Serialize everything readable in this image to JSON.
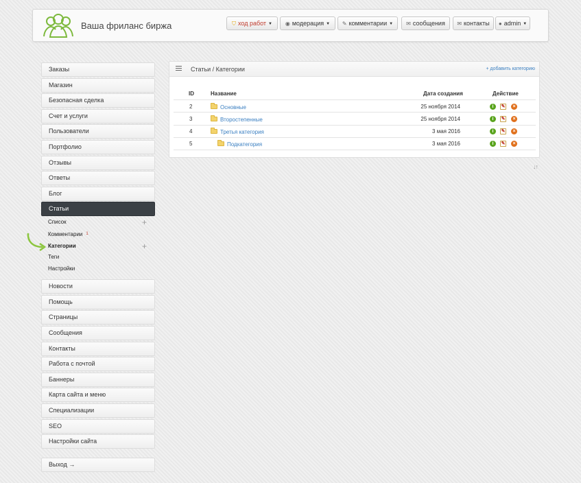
{
  "header": {
    "site_title": "Ваша фриланс биржа",
    "nav": [
      {
        "label": "ход работ",
        "icon": "shield-icon",
        "caret": true
      },
      {
        "label": "модерация",
        "icon": "eye-icon",
        "caret": true
      },
      {
        "label": "комментарии",
        "icon": "pencil-icon",
        "caret": true
      },
      {
        "label": "сообщения",
        "icon": "envelope-icon",
        "caret": false
      },
      {
        "label": "контакты",
        "icon": "envelope-icon",
        "caret": false
      },
      {
        "label": "admin",
        "icon": "user-icon",
        "caret": true
      }
    ]
  },
  "sidebar": {
    "items_top": [
      "Заказы",
      "Магазин",
      "Безопасная сделка",
      "Счет и услуги",
      "Пользователи",
      "Портфолио",
      "Отзывы",
      "Ответы",
      "Блог"
    ],
    "active": "Статьи",
    "sub": [
      {
        "label": "Список",
        "plus": true
      },
      {
        "label": "Комментарии",
        "badge": "1"
      },
      {
        "label": "Категории",
        "plus": true,
        "current": true
      },
      {
        "label": "Теги"
      },
      {
        "label": "Настройки"
      }
    ],
    "items_bottom": [
      "Новости",
      "Помощь",
      "Страницы",
      "Сообщения",
      "Контакты",
      "Работа с почтой",
      "Баннеры",
      "Карта сайта и меню",
      "Специализации",
      "SEO",
      "Настройки сайта"
    ],
    "logout": "Выход →"
  },
  "panel": {
    "title": "Статьи / Категории",
    "add_link": "+ добавить категорию",
    "columns": {
      "id": "ID",
      "name": "Название",
      "date": "Дата создания",
      "action": "Действие"
    },
    "rows": [
      {
        "id": "2",
        "name": "Основные",
        "date": "25 ноября 2014",
        "indent": 0
      },
      {
        "id": "3",
        "name": "Второстепенные",
        "date": "25 ноября 2014",
        "indent": 0
      },
      {
        "id": "4",
        "name": "Третья категория",
        "date": "3 мая 2016",
        "indent": 0
      },
      {
        "id": "5",
        "name": "Подкатегория",
        "date": "3 мая 2016",
        "indent": 1
      }
    ],
    "sort_icon": "↓↑"
  },
  "colors": {
    "accent_link": "#3a7fc1",
    "active_sidebar": "#3b4045",
    "warn_text": "#c0392b",
    "logo_green": "#7cb93c"
  }
}
